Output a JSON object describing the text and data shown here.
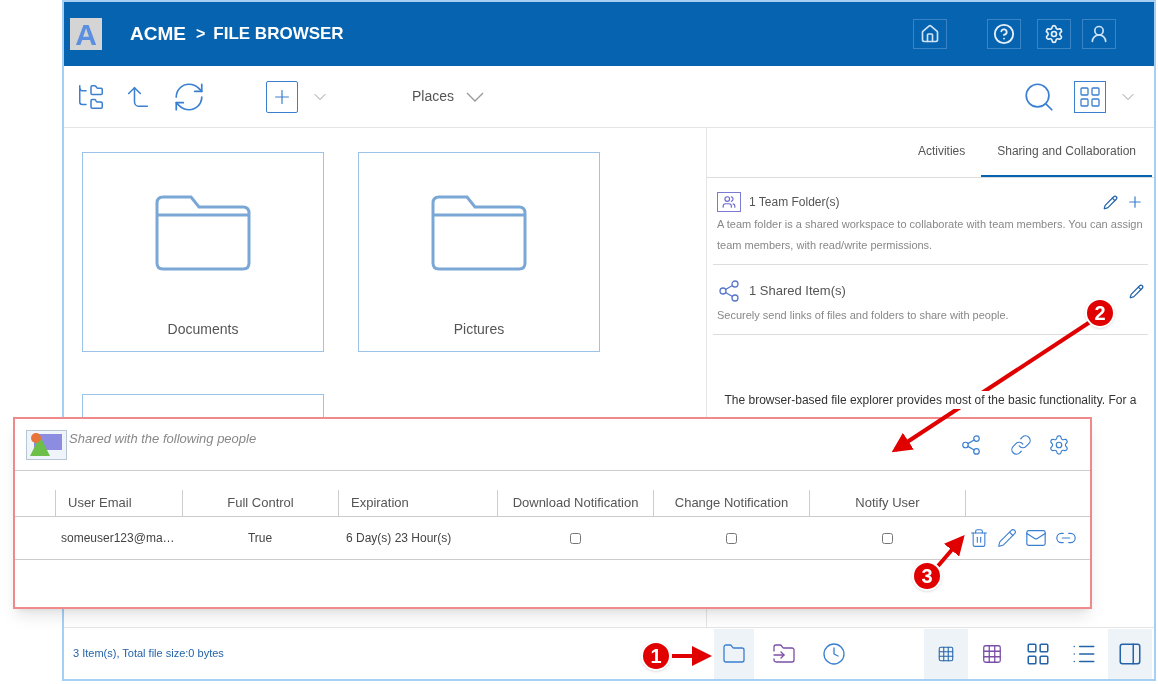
{
  "header": {
    "logo": "A",
    "breadcrumb": [
      "ACME",
      "FILE BROWSER"
    ],
    "separator": ">"
  },
  "toolbar": {
    "places": "Places"
  },
  "folders": [
    {
      "kind": "folder",
      "name": "Documents"
    },
    {
      "kind": "folder",
      "name": "Pictures"
    },
    {
      "kind": "covered"
    }
  ],
  "tabs": [
    {
      "label": "Activities",
      "selected": false
    },
    {
      "label": "Sharing and Collaboration",
      "selected": true
    }
  ],
  "sections": [
    {
      "kind": "team",
      "title": "1 Team Folder(s)",
      "text": "A team folder is a shared workspace to collaborate with team members. You can assign team members, with read/write permissions."
    },
    {
      "kind": "shared",
      "title": "1 Shared Item(s)",
      "text": "Securely send links of files and folders to share with people."
    }
  ],
  "info_text": "The browser-based file explorer provides most of the basic functionality. For a",
  "status": "3 Item(s), Total file size:0 bytes",
  "footer_tabs": [
    {
      "kind": "cloud",
      "selected": true
    },
    {
      "kind": "share",
      "selected": false
    },
    {
      "kind": "recent",
      "selected": false
    }
  ],
  "view_modes": [
    {
      "kind": "small",
      "selected": true
    },
    {
      "kind": "medium",
      "selected": false
    },
    {
      "kind": "large",
      "selected": false
    },
    {
      "kind": "list",
      "selected": false
    },
    {
      "kind": "panel",
      "selected": true
    }
  ],
  "share_panel": {
    "title": "Shared with the following people",
    "columns": [
      "User Email",
      "Full Control",
      "Expiration",
      "Download Notification",
      "Change Notification",
      "Notify User"
    ],
    "rows": [
      {
        "email": "someuser123@ma…",
        "full_control": "True",
        "expiration": "6 Day(s) 23 Hour(s)",
        "download_notification": false,
        "change_notification": false,
        "notify_user": false
      }
    ]
  },
  "annotations": [
    {
      "label": "1"
    },
    {
      "label": "2"
    },
    {
      "label": "3"
    }
  ]
}
